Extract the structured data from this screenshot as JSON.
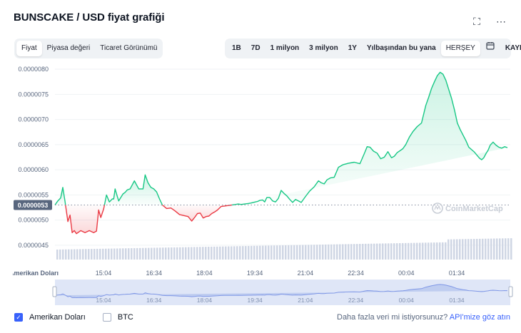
{
  "header": {
    "title": "BUNSCAKE / USD fiyat grafiği",
    "fullscreen_icon": "fullscreen-icon",
    "more_icon": "more-icon"
  },
  "tabs_left": [
    {
      "label": "Fiyat",
      "active": true
    },
    {
      "label": "Piyasa değeri",
      "active": false
    },
    {
      "label": "Ticaret Görünümü",
      "active": false
    }
  ],
  "ranges": [
    {
      "label": "1B",
      "active": false
    },
    {
      "label": "7D",
      "active": false
    },
    {
      "label": "1 milyon",
      "active": false
    },
    {
      "label": "3 milyon",
      "active": false
    },
    {
      "label": "1Y",
      "active": false
    },
    {
      "label": "Yılbaşından bu yana",
      "active": false
    },
    {
      "label": "HERŞEY",
      "active": true
    }
  ],
  "calendar_icon": "calendar-icon",
  "export_label": "KAYIT",
  "colors": {
    "up": "#16c784",
    "down": "#ea3943",
    "accent": "#3861fb",
    "volume": "#cfd6e4"
  },
  "chart_data": {
    "type": "line",
    "y_ticks": [
      "0.0000080",
      "0.0000075",
      "0.0000070",
      "0.0000065",
      "0.0000060",
      "0.0000055",
      "0.0000050",
      "0.0000045"
    ],
    "x_ticks": [
      "15:04",
      "16:34",
      "18:04",
      "19:34",
      "21:04",
      "22:34",
      "00:04",
      "01:34"
    ],
    "ylim": [
      4.3e-06,
      8.1e-06
    ],
    "reference_price": 5.3e-06,
    "reference_label": "0.0000053",
    "series": [
      {
        "name": "Amerikan Doları",
        "t": [
          0,
          4,
          8,
          11,
          14,
          18,
          21,
          24,
          27,
          30,
          36,
          42,
          48,
          54,
          58,
          61,
          64,
          68,
          72,
          76,
          80,
          82,
          84,
          86,
          89,
          92,
          95,
          98,
          101,
          105,
          111,
          117,
          123,
          126,
          130,
          134,
          138,
          142,
          146,
          150,
          156,
          162,
          168,
          174,
          180,
          186,
          191,
          195,
          199,
          203,
          207,
          211,
          215,
          219,
          223,
          227,
          232,
          237,
          242,
          247,
          252,
          256,
          260,
          265,
          270,
          274,
          277,
          280,
          283,
          286,
          290,
          293,
          296,
          300,
          304,
          308,
          312,
          316,
          320,
          324,
          328,
          332,
          336,
          340,
          344,
          350,
          356,
          362,
          368,
          372,
          376,
          380,
          385,
          390,
          396,
          402,
          410,
          418,
          426,
          432,
          436,
          440,
          445,
          450,
          455,
          460,
          465,
          470,
          474,
          478,
          482,
          486,
          490,
          495,
          500,
          506,
          512,
          518,
          522,
          526,
          530,
          534,
          538,
          542,
          546,
          550,
          554,
          558,
          562,
          566,
          570,
          574,
          578,
          582,
          586,
          590,
          593,
          596,
          599,
          602,
          605,
          608,
          612,
          616,
          620,
          624,
          628,
          632,
          636
        ],
        "values": [
          5.3e-06,
          5.38e-06,
          5.44e-06,
          5.65e-06,
          5.38e-06,
          4.97e-06,
          5.1e-06,
          4.75e-06,
          4.79e-06,
          4.73e-06,
          4.79e-06,
          4.75e-06,
          4.79e-06,
          4.75e-06,
          4.78e-06,
          5.2e-06,
          5.05e-06,
          5.22e-06,
          5.5e-06,
          5.36e-06,
          5.42e-06,
          5.42e-06,
          5.62e-06,
          5.52e-06,
          5.38e-06,
          5.45e-06,
          5.52e-06,
          5.55e-06,
          5.6e-06,
          5.62e-06,
          5.78e-06,
          5.62e-06,
          5.62e-06,
          5.9e-06,
          5.74e-06,
          5.65e-06,
          5.62e-06,
          5.56e-06,
          5.42e-06,
          5.3e-06,
          5.23e-06,
          5.24e-06,
          5.18e-06,
          5.11e-06,
          5.09e-06,
          5.07e-06,
          4.98e-06,
          5.05e-06,
          5.13e-06,
          5.14e-06,
          5.04e-06,
          5.07e-06,
          5.08e-06,
          5.13e-06,
          5.16e-06,
          5.2e-06,
          5.27e-06,
          5.28e-06,
          5.29e-06,
          5.3e-06,
          5.31e-06,
          5.32e-06,
          5.31e-06,
          5.32e-06,
          5.33e-06,
          5.34e-06,
          5.35e-06,
          5.36e-06,
          5.37e-06,
          5.39e-06,
          5.4e-06,
          5.36e-06,
          5.45e-06,
          5.45e-06,
          5.38e-06,
          5.36e-06,
          5.43e-06,
          5.59e-06,
          5.53e-06,
          5.48e-06,
          5.41e-06,
          5.35e-06,
          5.41e-06,
          5.38e-06,
          5.35e-06,
          5.47e-06,
          5.58e-06,
          5.66e-06,
          5.78e-06,
          5.74e-06,
          5.72e-06,
          5.8e-06,
          5.84e-06,
          5.85e-06,
          6.05e-06,
          6.1e-06,
          6.13e-06,
          6.15e-06,
          6.12e-06,
          6.32e-06,
          6.46e-06,
          6.45e-06,
          6.37e-06,
          6.33e-06,
          6.22e-06,
          6.25e-06,
          6.36e-06,
          6.24e-06,
          6.27e-06,
          6.34e-06,
          6.38e-06,
          6.42e-06,
          6.5e-06,
          6.65e-06,
          6.76e-06,
          6.86e-06,
          6.93e-06,
          7.28e-06,
          7.44e-06,
          7.62e-06,
          7.75e-06,
          7.87e-06,
          7.94e-06,
          7.9e-06,
          7.78e-06,
          7.6e-06,
          7.42e-06,
          7.19e-06,
          6.93e-06,
          6.8e-06,
          6.69e-06,
          6.58e-06,
          6.45e-06,
          6.4e-06,
          6.35e-06,
          6.28e-06,
          6.23e-06,
          6.2e-06,
          6.24e-06,
          6.32e-06,
          6.39e-06,
          6.49e-06,
          6.55e-06,
          6.49e-06,
          6.45e-06,
          6.43e-06,
          6.46e-06,
          6.44e-06
        ]
      }
    ],
    "volume_label": "Amerikan Doları",
    "watermark": "CoinMarketCap",
    "grid": true
  },
  "footer": {
    "usd_label": "Amerikan Doları",
    "btc_label": "BTC",
    "api_question": "Daha fazla veri mi istiyorsunuz?",
    "api_link": "API'mize göz atın"
  }
}
